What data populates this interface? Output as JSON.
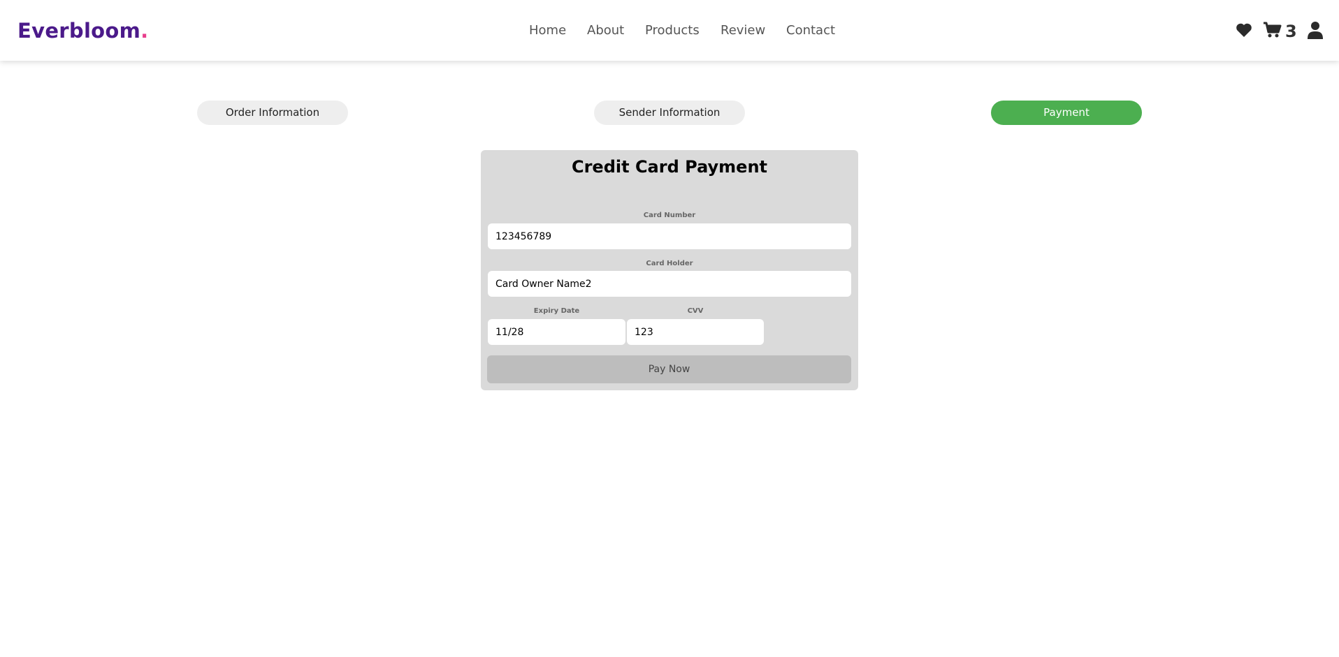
{
  "brand": {
    "name": "Everbloom",
    "dot": "."
  },
  "nav": {
    "items": [
      "Home",
      "About",
      "Products",
      "Review",
      "Contact"
    ]
  },
  "header_icons": {
    "wishlist": "heart-icon",
    "cart": "cart-icon",
    "cart_count": "3",
    "account": "user-icon"
  },
  "steps": {
    "items": [
      "Order Information",
      "Sender Information",
      "Payment"
    ],
    "active": "Payment",
    "active_color": "#4caf50"
  },
  "payment": {
    "title": "Credit Card Payment",
    "card_number_label": "Card Number",
    "card_number_value": "123456789",
    "card_holder_label": "Card Holder",
    "card_holder_value": "Card Owner Name2",
    "expiry_label": "Expiry Date",
    "expiry_value": "11/28",
    "cvv_label": "CVV",
    "cvv_value": "123",
    "pay_button": "Pay Now"
  },
  "colors": {
    "brand": "#4b1a8a",
    "brand_dot": "#e83e8c",
    "card_bg": "#dadada",
    "button_disabled": "#bdbdbd"
  }
}
